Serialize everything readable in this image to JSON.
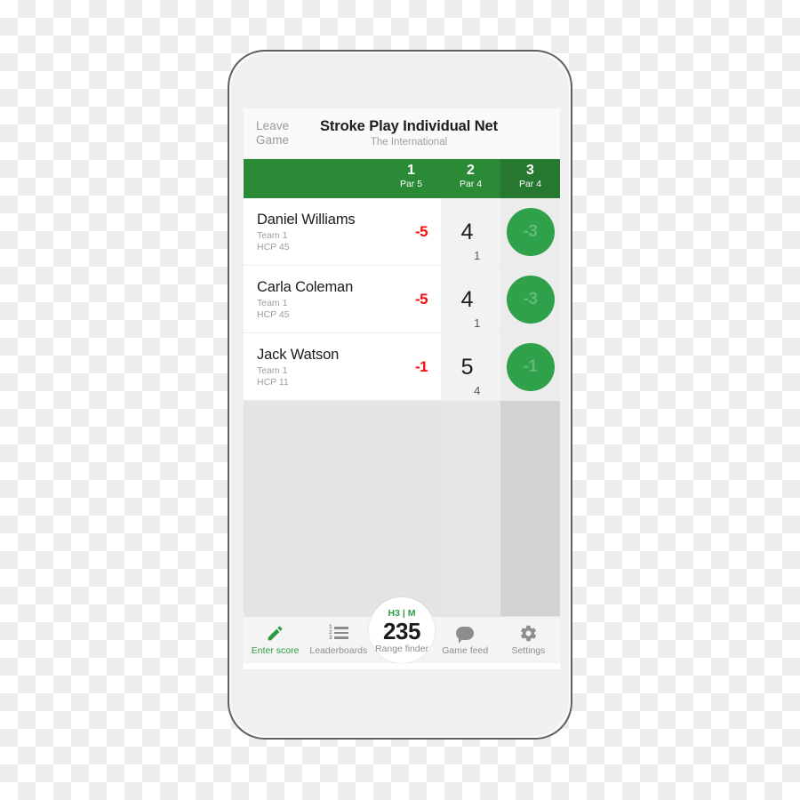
{
  "device": {
    "camera_icon": "camera-icon",
    "speaker_icon": "speaker-grille",
    "sensor_icon": "proximity-sensor"
  },
  "header": {
    "leave_game_line1": "Leave",
    "leave_game_line2": "Game",
    "title": "Stroke Play Individual Net",
    "subtitle": "The International"
  },
  "colors": {
    "green_header": "#2b8a36",
    "green_header_active": "#26772f",
    "green_accent": "#2e9b43",
    "circle_green": "#2fa14a",
    "circle_text": "#62b977",
    "score_red": "#fb0b0b"
  },
  "columns": [
    {
      "hole": "1",
      "par": "Par 5",
      "active": false
    },
    {
      "hole": "2",
      "par": "Par 4",
      "active": false
    },
    {
      "hole": "3",
      "par": "Par 4",
      "active": true
    }
  ],
  "players": [
    {
      "name": "Daniel Williams",
      "team": "Team 1",
      "hcp": "HCP 45",
      "total": "-5",
      "score_main": "4",
      "score_sub": "1",
      "circle": "-3"
    },
    {
      "name": "Carla Coleman",
      "team": "Team 1",
      "hcp": "HCP 45",
      "total": "-5",
      "score_main": "4",
      "score_sub": "1",
      "circle": "-3"
    },
    {
      "name": "Jack Watson",
      "team": "Team 1",
      "hcp": "HCP 11",
      "total": "-1",
      "score_main": "5",
      "score_sub": "4",
      "circle": "-1"
    }
  ],
  "nav": {
    "items": [
      {
        "label": "Enter score",
        "icon": "pencil-icon",
        "active": true
      },
      {
        "label": "Leaderboards",
        "icon": "numbered-list-icon",
        "active": false
      },
      {
        "label": "Game feed",
        "icon": "speech-bubble-icon",
        "active": false
      },
      {
        "label": "Settings",
        "icon": "gear-icon",
        "active": false
      }
    ],
    "rangefinder": {
      "unit": "H3 | M",
      "value": "235",
      "label": "Range finder"
    }
  }
}
